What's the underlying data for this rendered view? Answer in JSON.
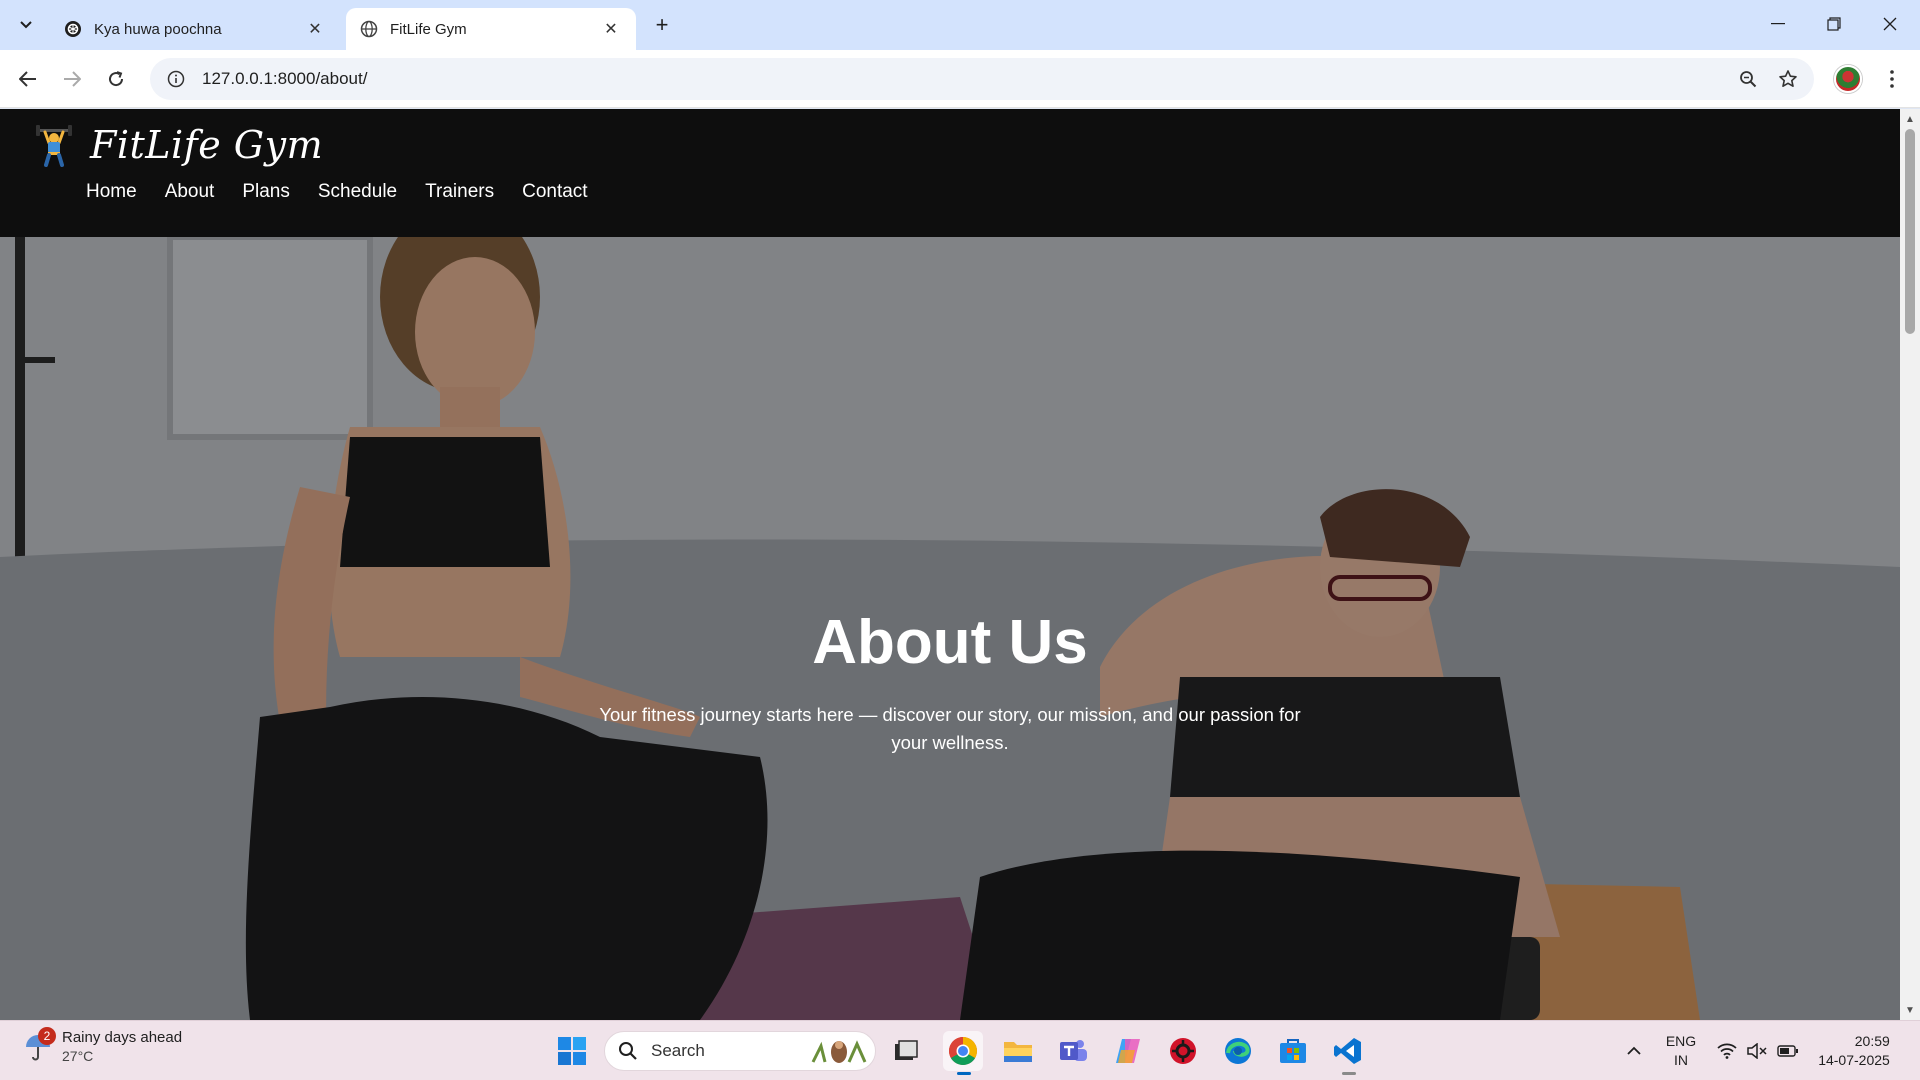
{
  "browser": {
    "tabs": [
      {
        "title": "Kya huwa poochna",
        "active": false
      },
      {
        "title": "FitLife Gym",
        "active": true
      }
    ],
    "url": "127.0.0.1:8000/about/"
  },
  "site": {
    "logo_text": "FitLife Gym",
    "nav": [
      "Home",
      "About",
      "Plans",
      "Schedule",
      "Trainers",
      "Contact"
    ],
    "hero_title": "About Us",
    "hero_subtitle": "Your fitness journey starts here — discover our story, our mission, and our passion for your wellness."
  },
  "taskbar": {
    "weather_badge": "2",
    "weather_line1": "Rainy days ahead",
    "weather_line2": "27°C",
    "search_placeholder": "Search",
    "lang_line1": "ENG",
    "lang_line2": "IN",
    "time": "20:59",
    "date": "14-07-2025"
  },
  "icons": {
    "tab_strip": [
      "tab-search-icon",
      "chatgpt-favicon-icon",
      "globe-favicon-icon",
      "close-icon",
      "new-tab-icon"
    ],
    "window": [
      "minimize-icon",
      "restore-icon",
      "close-window-icon"
    ],
    "toolbar": [
      "back-icon",
      "forward-icon",
      "reload-icon",
      "site-info-icon",
      "zoom-icon",
      "bookmark-star-icon",
      "profile-avatar",
      "more-menu-icon"
    ],
    "taskbar_apps": [
      "windows-start-icon",
      "task-view-icon",
      "chrome-icon",
      "file-explorer-icon",
      "teams-icon",
      "copilot-icon",
      "app-red-icon",
      "edge-icon",
      "ms-store-icon",
      "vscode-icon"
    ]
  },
  "colors": {
    "header_bg": "#0e0e0e",
    "tabstrip_bg": "#d3e3fd",
    "taskbar_bg": "#f0e3ea",
    "hero_text": "#ffffff"
  }
}
